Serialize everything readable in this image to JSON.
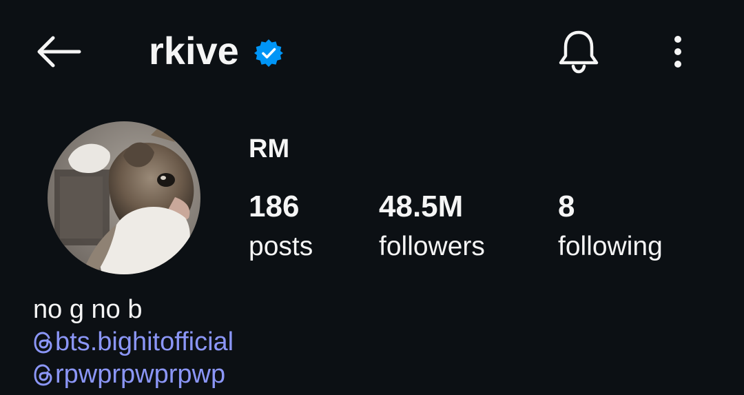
{
  "header": {
    "username": "rkive",
    "back_icon": "back-arrow-icon",
    "verified_icon": "verified-badge-icon",
    "bell_icon": "bell-icon",
    "more_icon": "more-vertical-icon"
  },
  "profile": {
    "display_name": "RM",
    "avatar": "cat-photo",
    "stats": {
      "posts_value": "186",
      "posts_label": "posts",
      "followers_value": "48.5M",
      "followers_label": "followers",
      "following_value": "8",
      "following_label": "following"
    },
    "bio": {
      "text": "no g no b",
      "links": [
        {
          "icon": "threads-icon",
          "text": "bts.bighitofficial"
        },
        {
          "icon": "threads-icon",
          "text": "rpwprpwprpwp"
        }
      ]
    }
  },
  "colors": {
    "background": "#0c1014",
    "text": "#f5f5f5",
    "link": "#8b96f7",
    "verified": "#0095f6"
  }
}
